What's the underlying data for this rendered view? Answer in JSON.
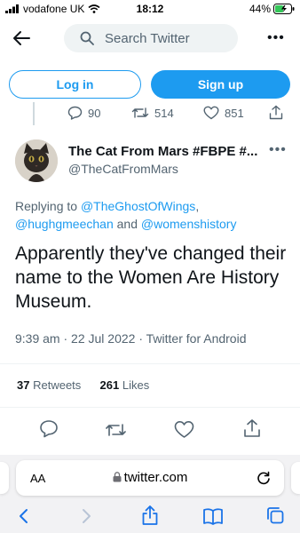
{
  "status_bar": {
    "carrier": "vodafone UK",
    "time": "18:12",
    "battery": "44%"
  },
  "header": {
    "search_placeholder": "Search Twitter",
    "more_label": "•••"
  },
  "auth": {
    "login_label": "Log in",
    "signup_label": "Sign up"
  },
  "parent_tweet_actions": {
    "replies": "90",
    "retweets": "514",
    "likes": "851"
  },
  "tweet": {
    "display_name": "The Cat From Mars #FBPE #...",
    "handle": "@TheCatFromMars",
    "more_label": "•••",
    "replying_prefix": "Replying to",
    "reply_user_1": "@TheGhostOfWings",
    "reply_user_2": "@hughgmeechan",
    "reply_and": "and",
    "reply_user_3": "@womenshistory",
    "text": "Apparently they've changed their name to the Women Are History Museum.",
    "time": "9:39 am",
    "date": "22 Jul 2022",
    "source": "Twitter for Android",
    "retweet_count": "37",
    "retweet_label": "Retweets",
    "like_count": "261",
    "like_label": "Likes"
  },
  "browser": {
    "text_size_label": "AA",
    "url": "twitter.com"
  },
  "colors": {
    "accent": "#1d9bf0",
    "text": "#0f1419",
    "secondary_text": "#536471",
    "browser_blue": "#1a73e8"
  },
  "icons": [
    "back-arrow-icon",
    "search-icon",
    "reply-icon",
    "retweet-icon",
    "like-icon",
    "share-icon",
    "lock-icon",
    "reload-icon",
    "bookmarks-icon",
    "tabs-icon"
  ]
}
